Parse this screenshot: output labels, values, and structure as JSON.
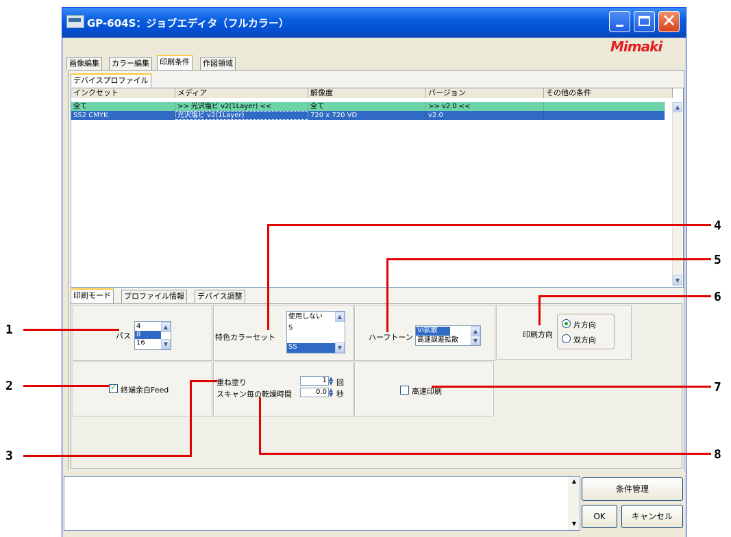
{
  "window": {
    "title": "GP-604S：ジョブエディタ（フルカラー）",
    "logo": "Mimaki",
    "buttons": {
      "minimize": "minimize",
      "maximize": "maximize",
      "close": "✕"
    }
  },
  "main_tabs": [
    "画像編集",
    "カラー編集",
    "印刷条件",
    "作図領域"
  ],
  "active_main_tab": "印刷条件",
  "sub_tab": "デバイスプロファイル",
  "profile_table": {
    "headers": [
      "インクセット",
      "メディア",
      "解像度",
      "バージョン",
      "その他の条件"
    ],
    "rows": [
      [
        "全て",
        ">> 光沢塩ビ v2(1Layer) <<",
        "全て",
        ">> v2.0 <<",
        ""
      ],
      [
        "SS2 CMYK",
        "光沢塩ビ v2(1Layer)",
        "720 x 720 VD",
        "v2.0",
        ""
      ]
    ]
  },
  "lower_tabs": [
    "印刷モード",
    "プロファイル情報",
    "デバイス調整"
  ],
  "print_mode": {
    "pass": {
      "label": "パス",
      "options": [
        "4",
        "8",
        "16"
      ],
      "selected": "8"
    },
    "special_color": {
      "label": "特色カラーセット",
      "options": [
        "使用しない",
        "S",
        "SS"
      ],
      "selected": "SS"
    },
    "halftone": {
      "label": "ハーフトーン",
      "options": [
        "VI拡散",
        "高速誤差拡散"
      ],
      "selected": "VI拡散"
    },
    "print_direction": {
      "label": "印刷方向",
      "options": [
        "片方向",
        "双方向"
      ],
      "selected": "片方向"
    },
    "end_margin_feed": {
      "label": "終端余白Feed",
      "checked": true
    },
    "overprint": {
      "label": "重ね塗り",
      "value": "1",
      "unit": "回"
    },
    "dry_time": {
      "label": "スキャン毎の乾燥時間",
      "value": "0.0",
      "unit": "秒"
    },
    "high_speed": {
      "label": "高速印刷",
      "checked": false
    }
  },
  "buttons": {
    "condition_mgmt": "条件管理",
    "ok": "OK",
    "cancel": "キャンセル"
  },
  "callouts": [
    "1",
    "2",
    "3",
    "4",
    "5",
    "6",
    "7",
    "8"
  ],
  "colors": {
    "title_bar": "#0a5fe0",
    "selection": "#316ac5",
    "row_highlight": "#6dd3a8",
    "callout_line": "#e10000",
    "logo": "#e02020"
  }
}
